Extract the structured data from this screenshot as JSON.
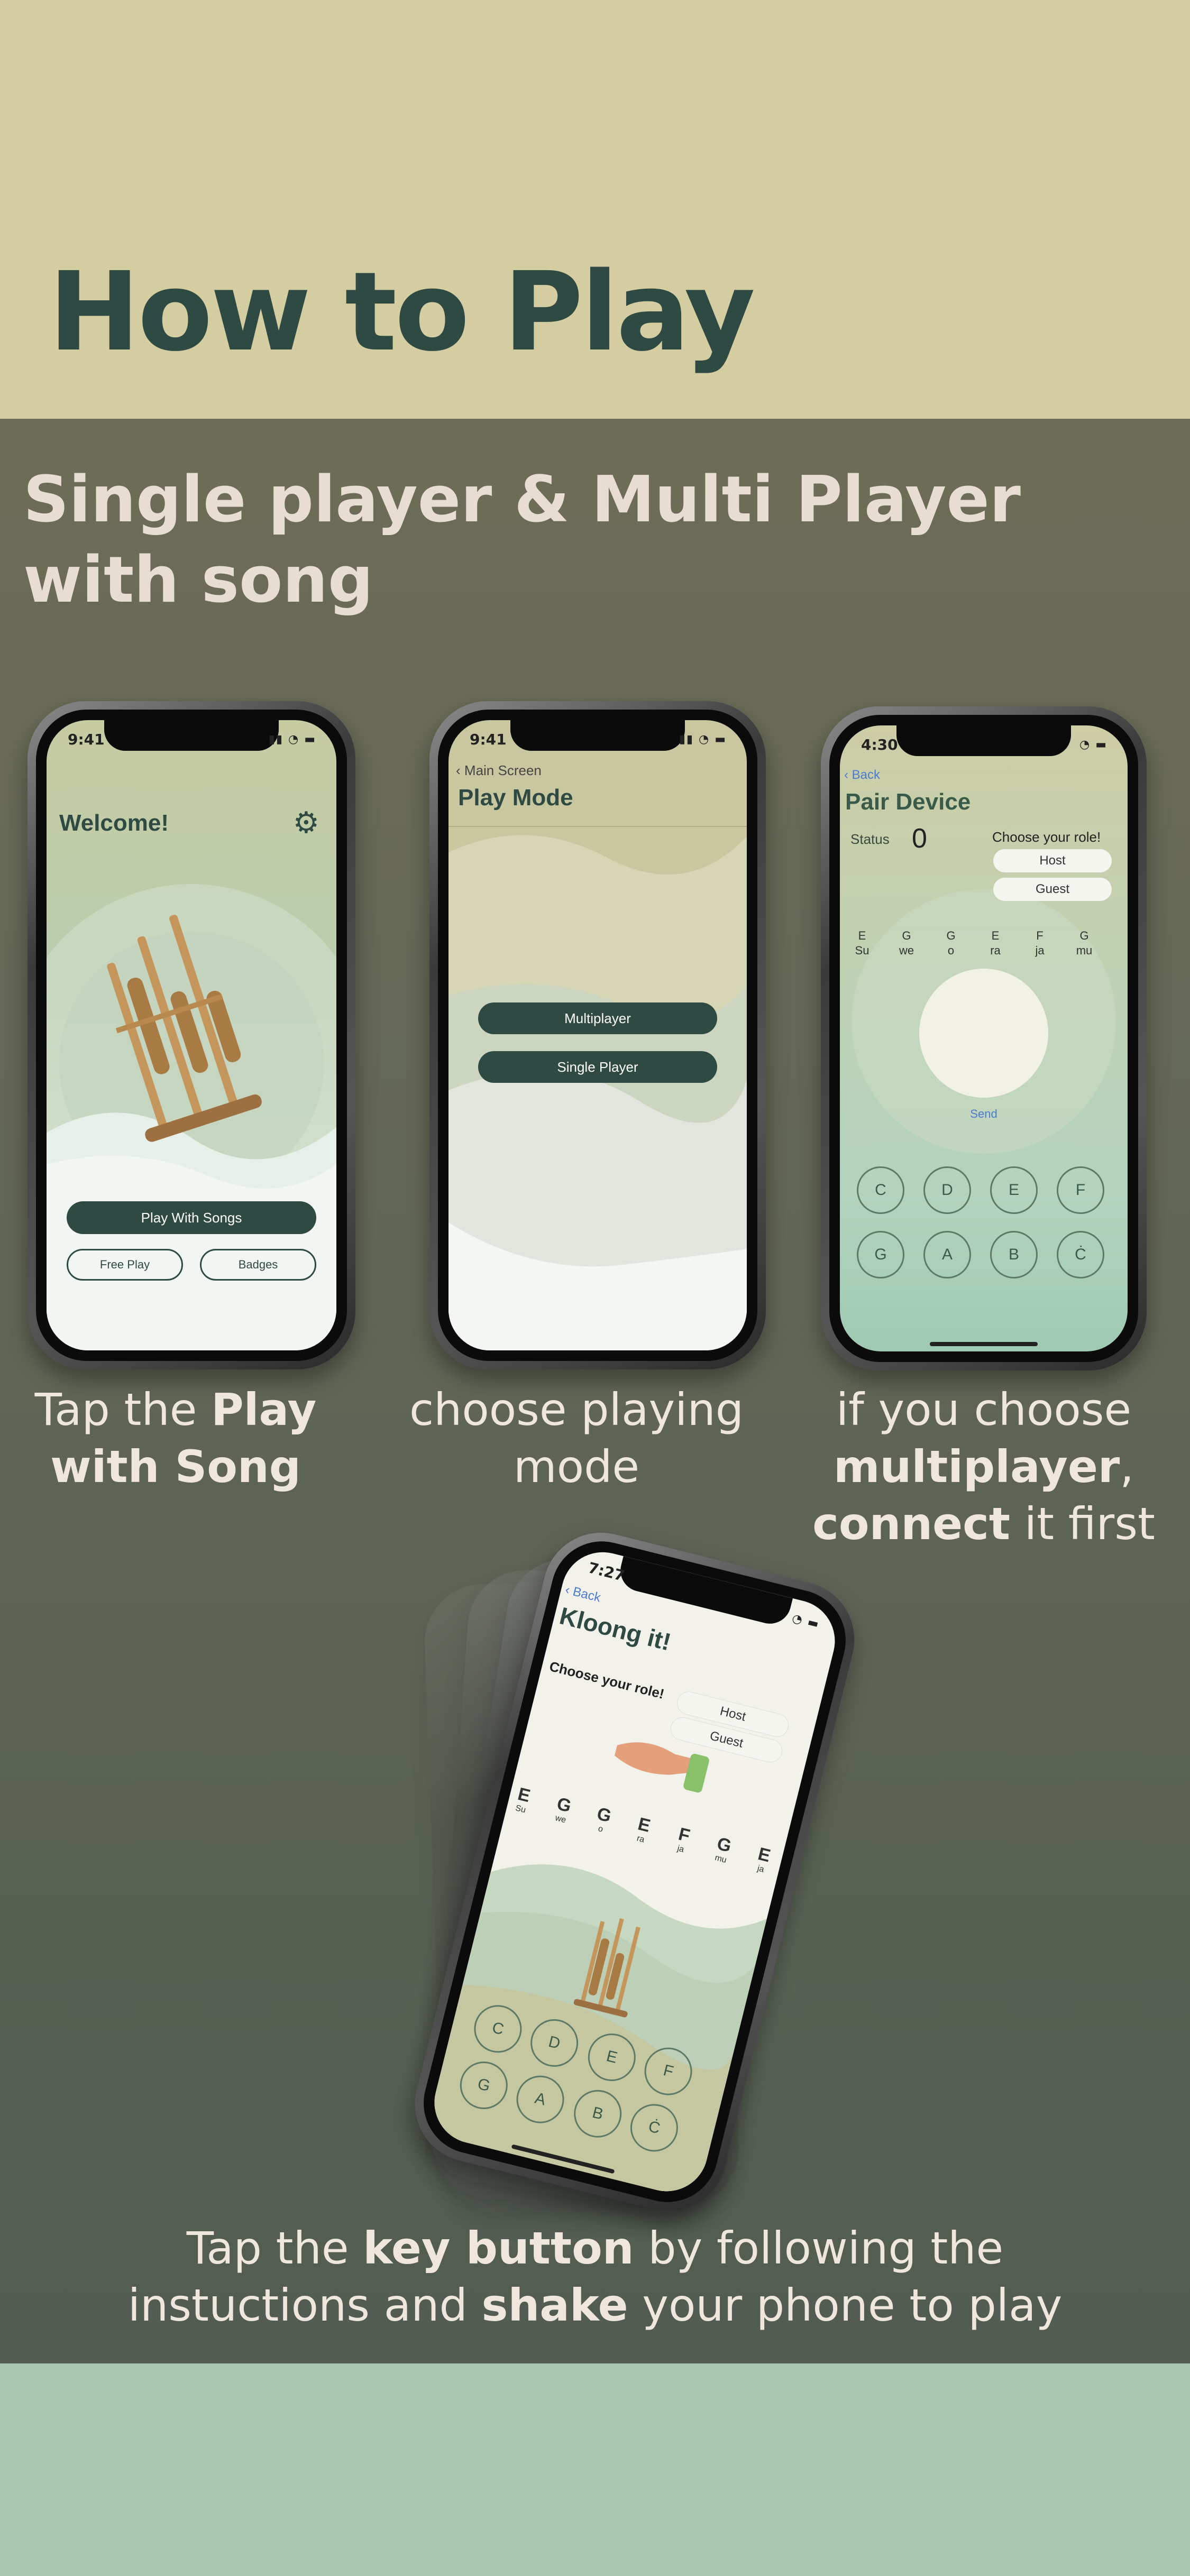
{
  "heading": "How to Play",
  "subtitle": "Single player & Multi Player with song",
  "captions": {
    "c1": {
      "pre": "Tap the ",
      "b1": "Play with Song"
    },
    "c2": {
      "text": "choose playing mode"
    },
    "c3": {
      "pre": "if you choose ",
      "b1": "multiplayer",
      "mid": ",",
      "b2": "connect",
      "post": " it first"
    },
    "c4": {
      "pre": "Tap the ",
      "b1": "key button",
      "mid": "  by following the instuctions and ",
      "b2": "shake",
      "post": " your phone to play"
    }
  },
  "phone1": {
    "time": "9:41",
    "welcome": "Welcome!",
    "play_with_songs": "Play With Songs",
    "free_play": "Free Play",
    "badges": "Badges"
  },
  "phone2": {
    "time": "9:41",
    "back": "Main Screen",
    "title": "Play Mode",
    "multiplayer": "Multiplayer",
    "single_player": "Single Player"
  },
  "phone3": {
    "time": "4:30",
    "back": "Back",
    "title": "Pair Device",
    "status_label": "Status",
    "status_value": "0",
    "choose_role": "Choose your role!",
    "host": "Host",
    "guest": "Guest",
    "send": "Send",
    "notes": [
      [
        "E",
        "Su"
      ],
      [
        "G",
        "we"
      ],
      [
        "G",
        "o"
      ],
      [
        "E",
        "ra"
      ],
      [
        "F",
        "ja"
      ],
      [
        "G",
        "mu"
      ]
    ],
    "keys_row1": [
      "C",
      "D",
      "E",
      "F"
    ],
    "keys_row2": [
      "G",
      "A",
      "B",
      "Ċ"
    ]
  },
  "phone4": {
    "time": "7:27",
    "back": "Back",
    "title": "Kloong it!",
    "choose_role": "Choose your role!",
    "host": "Host",
    "guest": "Guest",
    "notes": [
      [
        "E",
        "Su"
      ],
      [
        "G",
        "we"
      ],
      [
        "G",
        "o"
      ],
      [
        "E",
        "ra"
      ],
      [
        "F",
        "ja"
      ],
      [
        "G",
        "mu"
      ],
      [
        "E",
        "ja"
      ]
    ],
    "keys": [
      "C",
      "D",
      "E",
      "F",
      "G",
      "A",
      "B",
      "Ċ"
    ]
  },
  "colors": {
    "top_bg": "#d4cda1",
    "heading": "#2e4a42",
    "button": "#2f4a42",
    "bottom_bg": "#a8c8b2"
  }
}
